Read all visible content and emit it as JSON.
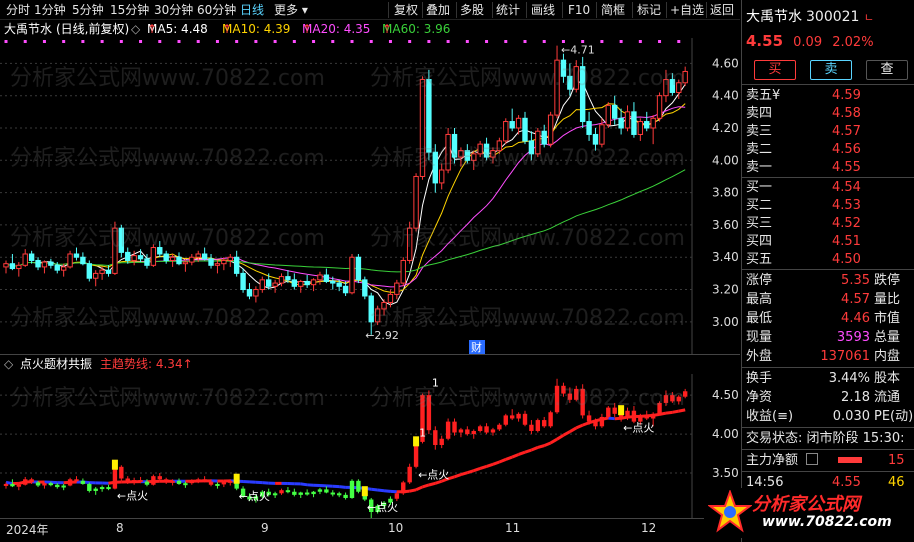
{
  "toolbar": {
    "periods": [
      "分时",
      "1分钟",
      "5分钟",
      "15分钟",
      "30分钟",
      "60分钟",
      "日线",
      "更多"
    ],
    "active_period": "日线",
    "tools": [
      "复权",
      "叠加",
      "多股",
      "统计",
      "画线",
      "F10",
      "简框",
      "标记",
      "+自选",
      "返回"
    ]
  },
  "chart_header": {
    "title": "大禹节水",
    "mode": "(日线,前复权)",
    "ma5": "MA5: 4.48",
    "ma10": "MA10: 4.39",
    "ma20": "MA20: 4.35",
    "ma60": "MA60: 3.96",
    "ma5_color": "#ffffff",
    "ma10_color": "#ffd400",
    "ma20_color": "#ff4dff",
    "ma60_color": "#3ad13a"
  },
  "main_axis": {
    "ticks": [
      "4.60",
      "4.40",
      "4.20",
      "4.00",
      "3.80",
      "3.60",
      "3.40",
      "3.20",
      "3.00"
    ],
    "high_label": "4.71",
    "low_label": "2.92",
    "event_badge": "财"
  },
  "sub_header": {
    "indicator": "点火题材共振",
    "line_label": "主趋势线: 4.34"
  },
  "sub_axis": {
    "ticks": [
      "4.50",
      "4.00",
      "3.50"
    ],
    "signal_text": "点火",
    "markers": [
      "1",
      "1"
    ]
  },
  "date_axis": {
    "labels": [
      "2024年",
      "8",
      "9",
      "10",
      "11",
      "12"
    ]
  },
  "chart_data": {
    "type": "candlestick",
    "xlabel": "",
    "ylabel": "",
    "ylim": [
      2.9,
      4.72
    ],
    "candles": [
      [
        3.34,
        3.38,
        3.3,
        3.36
      ],
      [
        3.36,
        3.42,
        3.32,
        3.33
      ],
      [
        3.33,
        3.37,
        3.28,
        3.35
      ],
      [
        3.35,
        3.45,
        3.34,
        3.42
      ],
      [
        3.42,
        3.44,
        3.36,
        3.38
      ],
      [
        3.38,
        3.4,
        3.32,
        3.34
      ],
      [
        3.34,
        3.38,
        3.3,
        3.37
      ],
      [
        3.37,
        3.39,
        3.33,
        3.35
      ],
      [
        3.35,
        3.37,
        3.3,
        3.32
      ],
      [
        3.32,
        3.36,
        3.28,
        3.34
      ],
      [
        3.34,
        3.44,
        3.33,
        3.42
      ],
      [
        3.42,
        3.46,
        3.38,
        3.4
      ],
      [
        3.4,
        3.43,
        3.35,
        3.36
      ],
      [
        3.36,
        3.38,
        3.25,
        3.27
      ],
      [
        3.27,
        3.32,
        3.22,
        3.3
      ],
      [
        3.3,
        3.34,
        3.26,
        3.32
      ],
      [
        3.32,
        3.35,
        3.28,
        3.3
      ],
      [
        3.3,
        3.62,
        3.29,
        3.58
      ],
      [
        3.58,
        3.6,
        3.4,
        3.43
      ],
      [
        3.43,
        3.46,
        3.36,
        3.38
      ],
      [
        3.38,
        3.44,
        3.35,
        3.41
      ],
      [
        3.41,
        3.45,
        3.37,
        3.39
      ],
      [
        3.39,
        3.42,
        3.33,
        3.35
      ],
      [
        3.35,
        3.48,
        3.34,
        3.46
      ],
      [
        3.46,
        3.5,
        3.4,
        3.42
      ],
      [
        3.42,
        3.44,
        3.36,
        3.38
      ],
      [
        3.38,
        3.42,
        3.34,
        3.4
      ],
      [
        3.4,
        3.43,
        3.35,
        3.36
      ],
      [
        3.36,
        3.39,
        3.31,
        3.37
      ],
      [
        3.37,
        3.42,
        3.35,
        3.4
      ],
      [
        3.4,
        3.44,
        3.37,
        3.42
      ],
      [
        3.42,
        3.46,
        3.38,
        3.39
      ],
      [
        3.39,
        3.42,
        3.33,
        3.35
      ],
      [
        3.35,
        3.38,
        3.3,
        3.36
      ],
      [
        3.36,
        3.4,
        3.32,
        3.38
      ],
      [
        3.38,
        3.42,
        3.34,
        3.4
      ],
      [
        3.4,
        3.44,
        3.28,
        3.3
      ],
      [
        3.3,
        3.33,
        3.18,
        3.2
      ],
      [
        3.2,
        3.24,
        3.14,
        3.16
      ],
      [
        3.16,
        3.22,
        3.12,
        3.2
      ],
      [
        3.2,
        3.28,
        3.18,
        3.26
      ],
      [
        3.26,
        3.3,
        3.2,
        3.22
      ],
      [
        3.22,
        3.26,
        3.18,
        3.24
      ],
      [
        3.24,
        3.3,
        3.22,
        3.28
      ],
      [
        3.28,
        3.32,
        3.24,
        3.26
      ],
      [
        3.26,
        3.3,
        3.2,
        3.22
      ],
      [
        3.22,
        3.26,
        3.18,
        3.25
      ],
      [
        3.25,
        3.29,
        3.21,
        3.23
      ],
      [
        3.23,
        3.27,
        3.19,
        3.26
      ],
      [
        3.26,
        3.31,
        3.23,
        3.29
      ],
      [
        3.29,
        3.33,
        3.24,
        3.25
      ],
      [
        3.25,
        3.28,
        3.2,
        3.24
      ],
      [
        3.24,
        3.26,
        3.19,
        3.22
      ],
      [
        3.22,
        3.25,
        3.16,
        3.18
      ],
      [
        3.18,
        3.42,
        3.17,
        3.4
      ],
      [
        3.4,
        3.42,
        3.24,
        3.26
      ],
      [
        3.26,
        3.28,
        3.14,
        3.16
      ],
      [
        3.16,
        3.18,
        2.92,
        3.0
      ],
      [
        3.0,
        3.1,
        2.98,
        3.08
      ],
      [
        3.08,
        3.14,
        3.04,
        3.12
      ],
      [
        3.12,
        3.2,
        3.09,
        3.17
      ],
      [
        3.17,
        3.26,
        3.14,
        3.24
      ],
      [
        3.24,
        3.4,
        3.22,
        3.38
      ],
      [
        3.38,
        3.62,
        3.36,
        3.58
      ],
      [
        3.58,
        3.92,
        3.56,
        3.9
      ],
      [
        3.9,
        4.52,
        3.88,
        4.5
      ],
      [
        4.5,
        4.56,
        4.0,
        4.05
      ],
      [
        4.05,
        4.1,
        3.8,
        3.86
      ],
      [
        3.86,
        3.98,
        3.82,
        3.94
      ],
      [
        3.94,
        4.2,
        3.92,
        4.16
      ],
      [
        4.16,
        4.2,
        3.98,
        4.02
      ],
      [
        4.02,
        4.08,
        3.96,
        4.06
      ],
      [
        4.06,
        4.1,
        3.98,
        4.0
      ],
      [
        4.0,
        4.06,
        3.94,
        4.04
      ],
      [
        4.04,
        4.12,
        4.02,
        4.1
      ],
      [
        4.1,
        4.14,
        4.0,
        4.02
      ],
      [
        4.02,
        4.08,
        3.98,
        4.06
      ],
      [
        4.06,
        4.14,
        4.04,
        4.12
      ],
      [
        4.12,
        4.26,
        4.1,
        4.24
      ],
      [
        4.24,
        4.32,
        4.18,
        4.2
      ],
      [
        4.2,
        4.28,
        4.16,
        4.26
      ],
      [
        4.26,
        4.3,
        4.1,
        4.12
      ],
      [
        4.12,
        4.18,
        4.0,
        4.04
      ],
      [
        4.04,
        4.2,
        4.02,
        4.18
      ],
      [
        4.18,
        4.22,
        4.08,
        4.1
      ],
      [
        4.1,
        4.3,
        4.08,
        4.28
      ],
      [
        4.28,
        4.71,
        4.26,
        4.62
      ],
      [
        4.62,
        4.66,
        4.48,
        4.52
      ],
      [
        4.52,
        4.6,
        4.4,
        4.44
      ],
      [
        4.44,
        4.62,
        4.42,
        4.58
      ],
      [
        4.58,
        4.64,
        4.2,
        4.24
      ],
      [
        4.24,
        4.3,
        4.12,
        4.16
      ],
      [
        4.16,
        4.2,
        4.06,
        4.1
      ],
      [
        4.1,
        4.26,
        4.08,
        4.22
      ],
      [
        4.22,
        4.36,
        4.2,
        4.34
      ],
      [
        4.34,
        4.4,
        4.22,
        4.26
      ],
      [
        4.26,
        4.32,
        4.16,
        4.2
      ],
      [
        4.2,
        4.34,
        4.18,
        4.3
      ],
      [
        4.3,
        4.36,
        4.14,
        4.16
      ],
      [
        4.16,
        4.26,
        4.12,
        4.24
      ],
      [
        4.24,
        4.3,
        4.18,
        4.2
      ],
      [
        4.2,
        4.28,
        4.1,
        4.26
      ],
      [
        4.26,
        4.42,
        4.24,
        4.4
      ],
      [
        4.4,
        4.56,
        4.36,
        4.5
      ],
      [
        4.5,
        4.54,
        4.4,
        4.42
      ],
      [
        4.42,
        4.5,
        4.38,
        4.48
      ],
      [
        4.48,
        4.58,
        4.46,
        4.55
      ]
    ],
    "ma_series": [
      {
        "name": "MA5",
        "color": "#ffffff"
      },
      {
        "name": "MA10",
        "color": "#ffd400"
      },
      {
        "name": "MA20",
        "color": "#ff4dff"
      },
      {
        "name": "MA60",
        "color": "#3ad13a"
      }
    ]
  },
  "quote": {
    "name": "大禹节水",
    "code": "300021",
    "price": "4.55",
    "change": "0.09",
    "change_pct": "2.02%",
    "buy_btn": "买",
    "sell_btn": "卖",
    "query_btn": "查",
    "yen_sign": "¥",
    "asks": [
      {
        "label": "卖五",
        "price": "4.59"
      },
      {
        "label": "卖四",
        "price": "4.58"
      },
      {
        "label": "卖三",
        "price": "4.57"
      },
      {
        "label": "卖二",
        "price": "4.56"
      },
      {
        "label": "卖一",
        "price": "4.55"
      }
    ],
    "bids": [
      {
        "label": "买一",
        "price": "4.54"
      },
      {
        "label": "买二",
        "price": "4.53"
      },
      {
        "label": "买三",
        "price": "4.52"
      },
      {
        "label": "买四",
        "price": "4.51"
      },
      {
        "label": "买五",
        "price": "4.50"
      }
    ],
    "stats": [
      {
        "label": "涨停",
        "value": "5.35",
        "label2": "跌停",
        "color": "#ff3b3b"
      },
      {
        "label": "最高",
        "value": "4.57",
        "label2": "量比",
        "color": "#ff3b3b"
      },
      {
        "label": "最低",
        "value": "4.46",
        "label2": "市值",
        "color": "#ff3b3b"
      },
      {
        "label": "现量",
        "value": "3593",
        "label2": "总量",
        "color": "#ff4dff"
      },
      {
        "label": "外盘",
        "value": "137061",
        "label2": "内盘",
        "color": "#ff3b3b"
      }
    ],
    "stats2": [
      {
        "label": "换手",
        "value": "3.44%",
        "label2": "股本",
        "color": "#e6e6e6"
      },
      {
        "label": "净资",
        "value": "2.18",
        "label2": "流通",
        "color": "#e6e6e6"
      },
      {
        "label": "收益(≡)",
        "value": "0.030",
        "label2": "PE(动)",
        "color": "#e6e6e6"
      }
    ],
    "trade_status": "交易状态: 闭市阶段 15:30:",
    "net_flow_label": "主力净额",
    "net_flow_value": "15",
    "tick_time": "14:56",
    "tick_price": "4.55",
    "tick_vol": "46"
  },
  "logo": {
    "name": "分析家公式网",
    "url": "www.70822.com"
  },
  "watermark": "分析家公式网www.70822.com"
}
